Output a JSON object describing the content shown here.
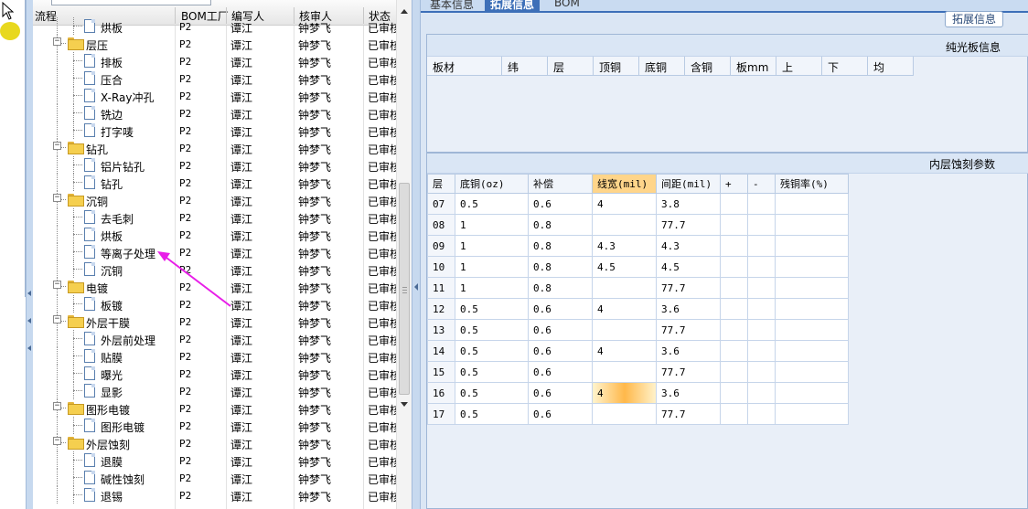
{
  "tree": {
    "columns": [
      "流程",
      "BOM工厂",
      "编写人",
      "核审人",
      "状态"
    ],
    "rows": [
      {
        "level": 2,
        "kind": "doc",
        "name": "烘板",
        "bom": "P2",
        "author": "谭江",
        "reviewer": "钟梦飞",
        "status": "已审核"
      },
      {
        "level": 1,
        "kind": "folder",
        "name": "层压",
        "bom": "P2",
        "author": "谭江",
        "reviewer": "钟梦飞",
        "status": "已审核"
      },
      {
        "level": 2,
        "kind": "doc",
        "name": "排板",
        "bom": "P2",
        "author": "谭江",
        "reviewer": "钟梦飞",
        "status": "已审核"
      },
      {
        "level": 2,
        "kind": "doc",
        "name": "压合",
        "bom": "P2",
        "author": "谭江",
        "reviewer": "钟梦飞",
        "status": "已审核"
      },
      {
        "level": 2,
        "kind": "doc",
        "name": "X-Ray冲孔",
        "bom": "P2",
        "author": "谭江",
        "reviewer": "钟梦飞",
        "status": "已审核"
      },
      {
        "level": 2,
        "kind": "doc",
        "name": "铣边",
        "bom": "P2",
        "author": "谭江",
        "reviewer": "钟梦飞",
        "status": "已审核"
      },
      {
        "level": 2,
        "kind": "doc",
        "name": "打字唛",
        "bom": "P2",
        "author": "谭江",
        "reviewer": "钟梦飞",
        "status": "已审核"
      },
      {
        "level": 1,
        "kind": "folder",
        "name": "钻孔",
        "bom": "P2",
        "author": "谭江",
        "reviewer": "钟梦飞",
        "status": "已审核"
      },
      {
        "level": 2,
        "kind": "doc",
        "name": "铝片钻孔",
        "bom": "P2",
        "author": "谭江",
        "reviewer": "钟梦飞",
        "status": "已审核"
      },
      {
        "level": 2,
        "kind": "doc",
        "name": "钻孔",
        "bom": "P2",
        "author": "谭江",
        "reviewer": "钟梦飞",
        "status": "已审核"
      },
      {
        "level": 1,
        "kind": "folder",
        "name": "沉铜",
        "bom": "P2",
        "author": "谭江",
        "reviewer": "钟梦飞",
        "status": "已审核"
      },
      {
        "level": 2,
        "kind": "doc",
        "name": "去毛刺",
        "bom": "P2",
        "author": "谭江",
        "reviewer": "钟梦飞",
        "status": "已审核"
      },
      {
        "level": 2,
        "kind": "doc",
        "name": "烘板",
        "bom": "P2",
        "author": "谭江",
        "reviewer": "钟梦飞",
        "status": "已审核"
      },
      {
        "level": 2,
        "kind": "doc",
        "name": "等离子处理",
        "bom": "P2",
        "author": "谭江",
        "reviewer": "钟梦飞",
        "status": "已审核"
      },
      {
        "level": 2,
        "kind": "doc",
        "name": "沉铜",
        "bom": "P2",
        "author": "谭江",
        "reviewer": "钟梦飞",
        "status": "已审核"
      },
      {
        "level": 1,
        "kind": "folder",
        "name": "电镀",
        "bom": "P2",
        "author": "谭江",
        "reviewer": "钟梦飞",
        "status": "已审核"
      },
      {
        "level": 2,
        "kind": "doc",
        "name": "板镀",
        "bom": "P2",
        "author": "谭江",
        "reviewer": "钟梦飞",
        "status": "已审核"
      },
      {
        "level": 1,
        "kind": "folder",
        "name": "外层干膜",
        "bom": "P2",
        "author": "谭江",
        "reviewer": "钟梦飞",
        "status": "已审核"
      },
      {
        "level": 2,
        "kind": "doc",
        "name": "外层前处理",
        "bom": "P2",
        "author": "谭江",
        "reviewer": "钟梦飞",
        "status": "已审核"
      },
      {
        "level": 2,
        "kind": "doc",
        "name": "贴膜",
        "bom": "P2",
        "author": "谭江",
        "reviewer": "钟梦飞",
        "status": "已审核"
      },
      {
        "level": 2,
        "kind": "doc",
        "name": "曝光",
        "bom": "P2",
        "author": "谭江",
        "reviewer": "钟梦飞",
        "status": "已审核"
      },
      {
        "level": 2,
        "kind": "doc",
        "name": "显影",
        "bom": "P2",
        "author": "谭江",
        "reviewer": "钟梦飞",
        "status": "已审核"
      },
      {
        "level": 1,
        "kind": "folder",
        "name": "图形电镀",
        "bom": "P2",
        "author": "谭江",
        "reviewer": "钟梦飞",
        "status": "已审核"
      },
      {
        "level": 2,
        "kind": "doc",
        "name": "图形电镀",
        "bom": "P2",
        "author": "谭江",
        "reviewer": "钟梦飞",
        "status": "已审核"
      },
      {
        "level": 1,
        "kind": "folder",
        "name": "外层蚀刻",
        "bom": "P2",
        "author": "谭江",
        "reviewer": "钟梦飞",
        "status": "已审核"
      },
      {
        "level": 2,
        "kind": "doc",
        "name": "退膜",
        "bom": "P2",
        "author": "谭江",
        "reviewer": "钟梦飞",
        "status": "已审核"
      },
      {
        "level": 2,
        "kind": "doc",
        "name": "碱性蚀刻",
        "bom": "P2",
        "author": "谭江",
        "reviewer": "钟梦飞",
        "status": "已审核"
      },
      {
        "level": 2,
        "kind": "doc",
        "name": "退锡",
        "bom": "P2",
        "author": "谭江",
        "reviewer": "钟梦飞",
        "status": "已审核"
      }
    ]
  },
  "tabs": [
    "基本信息",
    "拓展信息",
    "BOM"
  ],
  "ext_button": "拓展信息",
  "board_panel": {
    "title": "纯光板信息",
    "columns": [
      "板材",
      "纬",
      "层",
      "顶铜",
      "底铜",
      "含铜",
      "板mm",
      "上",
      "下",
      "均"
    ]
  },
  "etch_panel": {
    "title": "内层蚀刻参数",
    "columns": [
      "层",
      "底铜(oz)",
      "补偿",
      "线宽(mil)",
      "间距(mil)",
      "+",
      "-",
      "残铜率(%)"
    ],
    "highlight_column": 3,
    "selected_row": 9,
    "rows": [
      [
        "07",
        "0.5",
        "0.6",
        "4",
        "3.8",
        "",
        "",
        ""
      ],
      [
        "08",
        "1",
        "0.8",
        "",
        "77.7",
        "",
        "",
        ""
      ],
      [
        "09",
        "1",
        "0.8",
        "4.3",
        "4.3",
        "",
        "",
        ""
      ],
      [
        "10",
        "1",
        "0.8",
        "4.5",
        "4.5",
        "",
        "",
        ""
      ],
      [
        "11",
        "1",
        "0.8",
        "",
        "77.7",
        "",
        "",
        ""
      ],
      [
        "12",
        "0.5",
        "0.6",
        "4",
        "3.6",
        "",
        "",
        ""
      ],
      [
        "13",
        "0.5",
        "0.6",
        "",
        "77.7",
        "",
        "",
        ""
      ],
      [
        "14",
        "0.5",
        "0.6",
        "4",
        "3.6",
        "",
        "",
        ""
      ],
      [
        "15",
        "0.5",
        "0.6",
        "",
        "77.7",
        "",
        "",
        ""
      ],
      [
        "16",
        "0.5",
        "0.6",
        "4",
        "3.6",
        "",
        "",
        ""
      ],
      [
        "17",
        "0.5",
        "0.6",
        "",
        "77.7",
        "",
        "",
        ""
      ]
    ]
  },
  "colors": {
    "accent": "#3d6fb8",
    "annotation": "#e81ee8",
    "highlight": "#ffd58a"
  }
}
